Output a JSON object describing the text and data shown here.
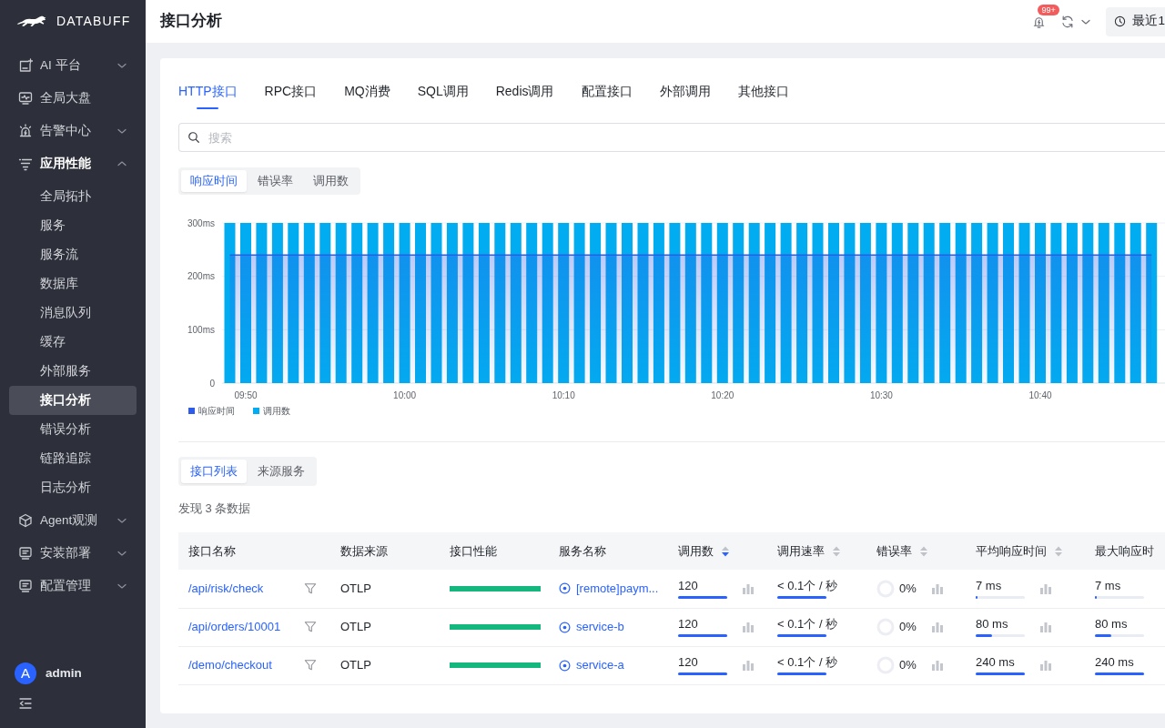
{
  "sidebar": {
    "brand": "DATABUFF",
    "items": [
      {
        "kind": "group",
        "label": "AI 平台",
        "expanded": false
      },
      {
        "kind": "link",
        "label": "全局大盘"
      },
      {
        "kind": "group",
        "label": "告警中心",
        "expanded": false
      },
      {
        "kind": "group",
        "label": "应用性能",
        "expanded": true,
        "children": [
          {
            "label": "全局拓扑",
            "selected": false
          },
          {
            "label": "服务",
            "selected": false
          },
          {
            "label": "服务流",
            "selected": false
          },
          {
            "label": "数据库",
            "selected": false
          },
          {
            "label": "消息队列",
            "selected": false
          },
          {
            "label": "缓存",
            "selected": false
          },
          {
            "label": "外部服务",
            "selected": false
          },
          {
            "label": "接口分析",
            "selected": true
          },
          {
            "label": "错误分析",
            "selected": false
          },
          {
            "label": "链路追踪",
            "selected": false
          },
          {
            "label": "日志分析",
            "selected": false
          }
        ]
      },
      {
        "kind": "group",
        "label": "Agent观测",
        "expanded": false
      },
      {
        "kind": "group",
        "label": "安装部署",
        "expanded": false
      },
      {
        "kind": "group",
        "label": "配置管理",
        "expanded": false
      }
    ],
    "user": {
      "initial": "A",
      "name": "admin"
    }
  },
  "header": {
    "title": "接口分析",
    "notification_count": "99+",
    "time_range": "最近1"
  },
  "tabs": [
    {
      "label": "HTTP接口",
      "selected": true
    },
    {
      "label": "RPC接口",
      "selected": false
    },
    {
      "label": "MQ消费",
      "selected": false
    },
    {
      "label": "SQL调用",
      "selected": false
    },
    {
      "label": "Redis调用",
      "selected": false
    },
    {
      "label": "配置接口",
      "selected": false
    },
    {
      "label": "外部调用",
      "selected": false
    },
    {
      "label": "其他接口",
      "selected": false
    }
  ],
  "search": {
    "placeholder": "搜索"
  },
  "chart_view": [
    {
      "label": "响应时间",
      "selected": true
    },
    {
      "label": "错误率",
      "selected": false
    },
    {
      "label": "调用数",
      "selected": false
    }
  ],
  "chart": {
    "chart_data": {
      "type": "bar",
      "legend": "bottom",
      "categories": [
        null,
        "09:50",
        null,
        null,
        null,
        null,
        null,
        null,
        null,
        null,
        null,
        "10:00",
        null,
        null,
        null,
        null,
        null,
        null,
        null,
        null,
        null,
        "10:10",
        null,
        null,
        null,
        null,
        null,
        null,
        null,
        null,
        null,
        "10:20",
        null,
        null,
        null,
        null,
        null,
        null,
        null,
        null,
        null,
        "10:30",
        null,
        null,
        null,
        null,
        null,
        null,
        null,
        null,
        null,
        "10:40",
        null,
        null,
        null,
        null,
        null,
        null,
        null
      ],
      "ylim": [
        0,
        300
      ],
      "yticks": [
        {
          "value": 0,
          "label": "0"
        },
        {
          "value": 100,
          "label": "100ms"
        },
        {
          "value": 200,
          "label": "200ms"
        },
        {
          "value": 300,
          "label": "300ms"
        }
      ],
      "series": [
        {
          "name": "响应时间",
          "type": "area",
          "color": "#2f5bea",
          "values": [
            240,
            240,
            240,
            240,
            240,
            240,
            240,
            240,
            240,
            240,
            240,
            240,
            240,
            240,
            240,
            240,
            240,
            240,
            240,
            240,
            240,
            240,
            240,
            240,
            240,
            240,
            240,
            240,
            240,
            240,
            240,
            240,
            240,
            240,
            240,
            240,
            240,
            240,
            240,
            240,
            240,
            240,
            240,
            240,
            240,
            240,
            240,
            240,
            240,
            240,
            240,
            240,
            240,
            240,
            240,
            240,
            240,
            240,
            240
          ]
        },
        {
          "name": "调用数",
          "type": "bar",
          "color": "#02acf0",
          "values": [
            300,
            300,
            300,
            300,
            300,
            300,
            300,
            300,
            300,
            300,
            300,
            300,
            300,
            300,
            300,
            300,
            300,
            300,
            300,
            300,
            300,
            300,
            300,
            300,
            300,
            300,
            300,
            300,
            300,
            300,
            300,
            300,
            300,
            300,
            300,
            300,
            300,
            300,
            300,
            300,
            300,
            300,
            300,
            300,
            300,
            300,
            300,
            300,
            300,
            300,
            300,
            300,
            300,
            300,
            300,
            300,
            300,
            300,
            300
          ]
        }
      ]
    }
  },
  "list_view": [
    {
      "label": "接口列表",
      "selected": true
    },
    {
      "label": "来源服务",
      "selected": false
    }
  ],
  "result_count": "发现 3 条数据",
  "table": {
    "columns": [
      {
        "label": "接口名称",
        "sortable": false
      },
      {
        "label": "数据来源",
        "sortable": false
      },
      {
        "label": "接口性能",
        "sortable": false
      },
      {
        "label": "服务名称",
        "sortable": false
      },
      {
        "label": "调用数",
        "sortable": true,
        "sort_desc": true
      },
      {
        "label": "调用速率",
        "sortable": true,
        "sort_desc": false
      },
      {
        "label": "错误率",
        "sortable": true,
        "sort_desc": false
      },
      {
        "label": "平均响应时间",
        "sortable": true,
        "sort_desc": false
      },
      {
        "label": "最大响应时",
        "sortable": false
      }
    ],
    "rows": [
      {
        "endpoint": "/api/risk/check",
        "source": "OTLP",
        "performance": {
          "level": 1
        },
        "service": "[remote]paym...",
        "calls": {
          "value": "120",
          "level": 1
        },
        "rate": {
          "value": "< 0.1个 / 秒",
          "level": 1
        },
        "error_rate": "0%",
        "avg_response": {
          "value": "7 ms",
          "level": 0.03
        },
        "max_response": {
          "value": "7 ms",
          "level": 0.03
        }
      },
      {
        "endpoint": "/api/orders/10001",
        "source": "OTLP",
        "performance": {
          "level": 1
        },
        "service": "service-b",
        "calls": {
          "value": "120",
          "level": 1
        },
        "rate": {
          "value": "< 0.1个 / 秒",
          "level": 1
        },
        "error_rate": "0%",
        "avg_response": {
          "value": "80 ms",
          "level": 0.33
        },
        "max_response": {
          "value": "80 ms",
          "level": 0.33
        }
      },
      {
        "endpoint": "/demo/checkout",
        "source": "OTLP",
        "performance": {
          "level": 1
        },
        "service": "service-a",
        "calls": {
          "value": "120",
          "level": 1
        },
        "rate": {
          "value": "< 0.1个 / 秒",
          "level": 1
        },
        "error_rate": "0%",
        "avg_response": {
          "value": "240 ms",
          "level": 1
        },
        "max_response": {
          "value": "240 ms",
          "level": 1
        }
      }
    ]
  }
}
